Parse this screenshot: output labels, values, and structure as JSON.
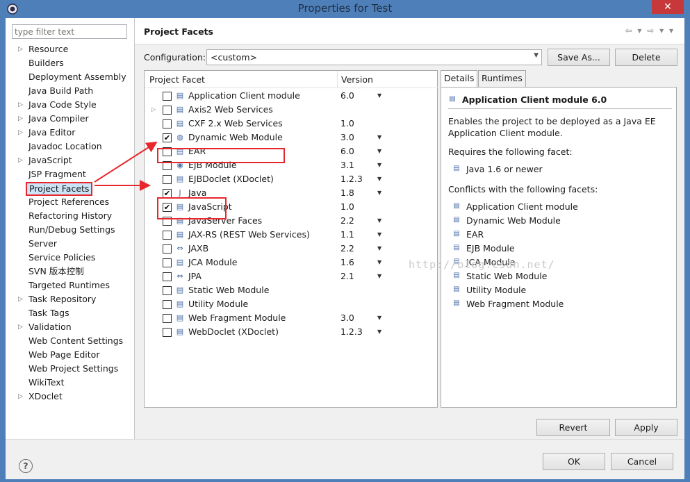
{
  "window": {
    "title": "Properties for Test",
    "close_label": "✕"
  },
  "filter": {
    "placeholder": "type filter text"
  },
  "tree": [
    {
      "label": "Resource",
      "expandable": true
    },
    {
      "label": "Builders",
      "expandable": false
    },
    {
      "label": "Deployment Assembly",
      "expandable": false
    },
    {
      "label": "Java Build Path",
      "expandable": false
    },
    {
      "label": "Java Code Style",
      "expandable": true
    },
    {
      "label": "Java Compiler",
      "expandable": true
    },
    {
      "label": "Java Editor",
      "expandable": true
    },
    {
      "label": "Javadoc Location",
      "expandable": false
    },
    {
      "label": "JavaScript",
      "expandable": true
    },
    {
      "label": "JSP Fragment",
      "expandable": false
    },
    {
      "label": "Project Facets",
      "expandable": false,
      "selected": true
    },
    {
      "label": "Project References",
      "expandable": false
    },
    {
      "label": "Refactoring History",
      "expandable": false
    },
    {
      "label": "Run/Debug Settings",
      "expandable": false
    },
    {
      "label": "Server",
      "expandable": false
    },
    {
      "label": "Service Policies",
      "expandable": false
    },
    {
      "label": "SVN 版本控制",
      "expandable": false
    },
    {
      "label": "Targeted Runtimes",
      "expandable": false
    },
    {
      "label": "Task Repository",
      "expandable": true
    },
    {
      "label": "Task Tags",
      "expandable": false
    },
    {
      "label": "Validation",
      "expandable": true
    },
    {
      "label": "Web Content Settings",
      "expandable": false
    },
    {
      "label": "Web Page Editor",
      "expandable": false
    },
    {
      "label": "Web Project Settings",
      "expandable": false
    },
    {
      "label": "WikiText",
      "expandable": false
    },
    {
      "label": "XDoclet",
      "expandable": true
    }
  ],
  "header": {
    "title": "Project Facets",
    "nav": "⇦ ▾ ⇨ ▾ ▾"
  },
  "configuration": {
    "label": "Configuration:",
    "value": "<custom>",
    "save_as": "Save As...",
    "delete": "Delete"
  },
  "facets_table": {
    "col_facet": "Project Facet",
    "col_version": "Version",
    "rows": [
      {
        "name": "Application Client module",
        "version": "6.0",
        "checked": false,
        "dropdown": true,
        "icon": "page-icon"
      },
      {
        "name": "Axis2 Web Services",
        "version": "",
        "checked": false,
        "dropdown": false,
        "expandable": true,
        "icon": "page-icon"
      },
      {
        "name": "CXF 2.x Web Services",
        "version": "1.0",
        "checked": false,
        "dropdown": false,
        "icon": "page-icon"
      },
      {
        "name": "Dynamic Web Module",
        "version": "3.0",
        "checked": true,
        "dropdown": true,
        "icon": "globe-icon"
      },
      {
        "name": "EAR",
        "version": "6.0",
        "checked": false,
        "dropdown": true,
        "icon": "page-icon"
      },
      {
        "name": "EJB Module",
        "version": "3.1",
        "checked": false,
        "dropdown": true,
        "icon": "bean-icon"
      },
      {
        "name": "EJBDoclet (XDoclet)",
        "version": "1.2.3",
        "checked": false,
        "dropdown": true,
        "icon": "page-icon"
      },
      {
        "name": "Java",
        "version": "1.8",
        "checked": true,
        "dropdown": true,
        "icon": "java-icon"
      },
      {
        "name": "JavaScript",
        "version": "1.0",
        "checked": true,
        "dropdown": false,
        "icon": "page-icon"
      },
      {
        "name": "JavaServer Faces",
        "version": "2.2",
        "checked": false,
        "dropdown": true,
        "icon": "page-icon"
      },
      {
        "name": "JAX-RS (REST Web Services)",
        "version": "1.1",
        "checked": false,
        "dropdown": true,
        "icon": "page-icon"
      },
      {
        "name": "JAXB",
        "version": "2.2",
        "checked": false,
        "dropdown": true,
        "icon": "jaxb-icon"
      },
      {
        "name": "JCA Module",
        "version": "1.6",
        "checked": false,
        "dropdown": true,
        "icon": "page-icon"
      },
      {
        "name": "JPA",
        "version": "2.1",
        "checked": false,
        "dropdown": true,
        "icon": "jpa-icon"
      },
      {
        "name": "Static Web Module",
        "version": "",
        "checked": false,
        "dropdown": false,
        "icon": "page-icon"
      },
      {
        "name": "Utility Module",
        "version": "",
        "checked": false,
        "dropdown": false,
        "icon": "page-icon"
      },
      {
        "name": "Web Fragment Module",
        "version": "3.0",
        "checked": false,
        "dropdown": true,
        "icon": "page-icon"
      },
      {
        "name": "WebDoclet (XDoclet)",
        "version": "1.2.3",
        "checked": false,
        "dropdown": true,
        "icon": "page-icon"
      }
    ]
  },
  "details": {
    "tab_details": "Details",
    "tab_runtimes": "Runtimes",
    "title": "Application Client module 6.0",
    "description": "Enables the project to be deployed as a Java EE Application Client module.",
    "requires_label": "Requires the following facet:",
    "requires": [
      "Java 1.6 or newer"
    ],
    "conflicts_label": "Conflicts with the following facets:",
    "conflicts": [
      "Application Client module",
      "Dynamic Web Module",
      "EAR",
      "EJB Module",
      "JCA Module",
      "Static Web Module",
      "Utility Module",
      "Web Fragment Module"
    ]
  },
  "buttons": {
    "revert": "Revert",
    "apply": "Apply",
    "ok": "OK",
    "cancel": "Cancel",
    "help": "?"
  },
  "watermark": "http://blog.csdn.net/",
  "colors": {
    "highlight": "#e8272c",
    "titlebar": "#4f7fb8",
    "selection": "#cce4f7"
  }
}
